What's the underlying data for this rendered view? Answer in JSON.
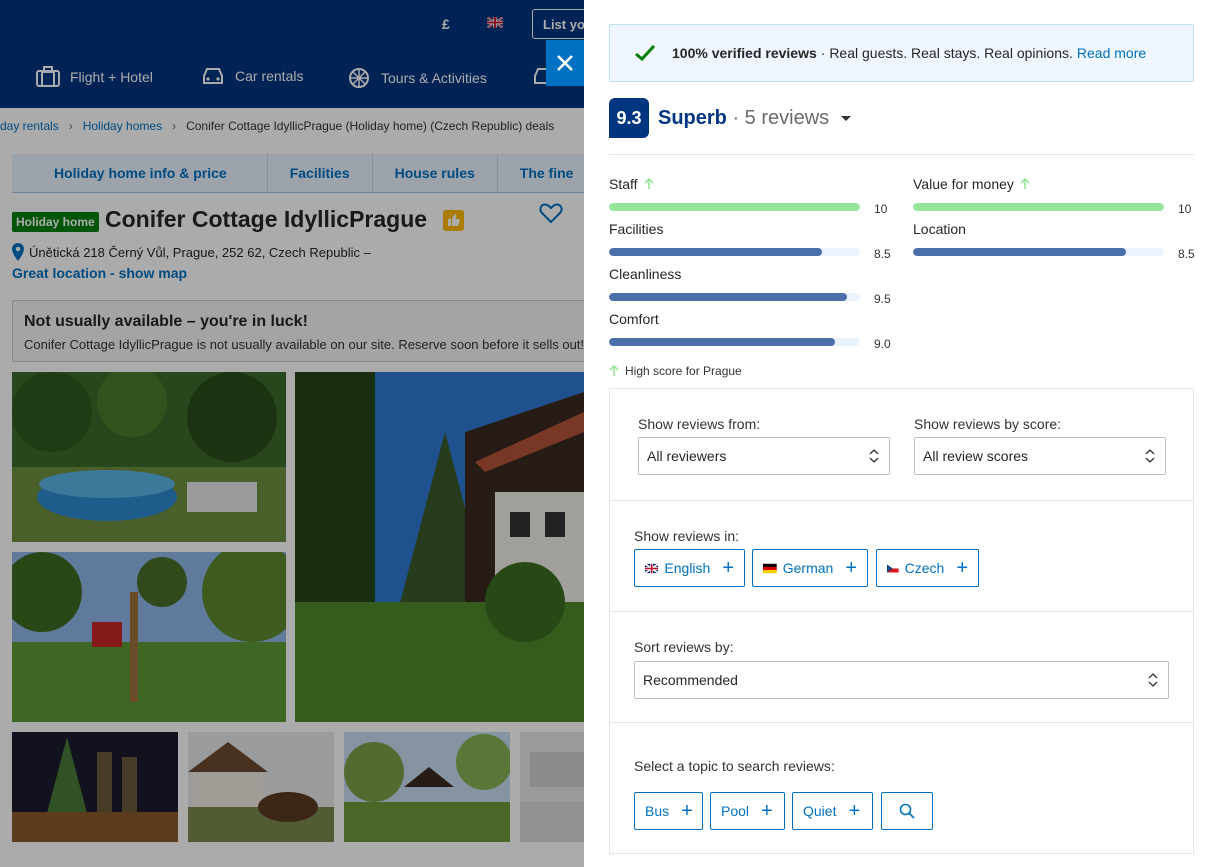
{
  "header": {
    "currency": "£",
    "list_property": "List your",
    "nav": [
      {
        "label": "Flight + Hotel",
        "icon": "suitcase-icon"
      },
      {
        "label": "Car rentals",
        "icon": "car-icon"
      },
      {
        "label": "Tours & Activities",
        "icon": "attractions-icon"
      }
    ]
  },
  "breadcrumb": [
    "day rentals",
    "Holiday homes",
    "Conifer Cottage IdyllicPrague (Holiday home) (Czech Republic) deals"
  ],
  "tabs": [
    "Holiday home info & price",
    "Facilities",
    "House rules",
    "The fine"
  ],
  "property": {
    "badge": "Holiday home",
    "name": "Conifer Cottage IdyllicPrague",
    "address": "Únětická 218 Černý Vůl, Prague, 252 62, Czech Republic –",
    "map_link": "Great location - show map",
    "luck_title": "Not usually available – you're in luck!",
    "luck_text": "Conifer Cottage IdyllicPrague is not usually available on our site. Reserve soon before it sells out!"
  },
  "reviews": {
    "verified_bold": "100% verified reviews",
    "verified_text": "· Real guests. Real stays. Real opinions.",
    "read_more": "Read more",
    "score": "9.3",
    "score_word": "Superb",
    "review_count": "· 5 reviews",
    "high_score_note": "High score for Prague",
    "categories": [
      {
        "name": "Staff",
        "value": "10",
        "fraction": 1.0,
        "high": true
      },
      {
        "name": "Value for money",
        "value": "10",
        "fraction": 1.0,
        "high": true
      },
      {
        "name": "Facilities",
        "value": "8.5",
        "fraction": 0.85,
        "high": false
      },
      {
        "name": "Location",
        "value": "8.5",
        "fraction": 0.85,
        "high": false
      },
      {
        "name": "Cleanliness",
        "value": "9.5",
        "fraction": 0.95,
        "high": false
      },
      {
        "name": "Comfort",
        "value": "9.0",
        "fraction": 0.9,
        "high": false
      }
    ],
    "filters": {
      "from_label": "Show reviews from:",
      "from_value": "All reviewers",
      "score_label": "Show reviews by score:",
      "score_value": "All review scores",
      "lang_label": "Show reviews in:",
      "languages": [
        "English",
        "German",
        "Czech"
      ],
      "sort_label": "Sort reviews by:",
      "sort_value": "Recommended",
      "topic_label": "Select a topic to search reviews:",
      "topics": [
        "Bus",
        "Pool",
        "Quiet"
      ]
    }
  },
  "colors": {
    "brand_blue": "#003580",
    "link_blue": "#0071c2",
    "bar_blue": "#4a6fab",
    "bar_green": "#97e59c",
    "badge_green": "#008009"
  }
}
